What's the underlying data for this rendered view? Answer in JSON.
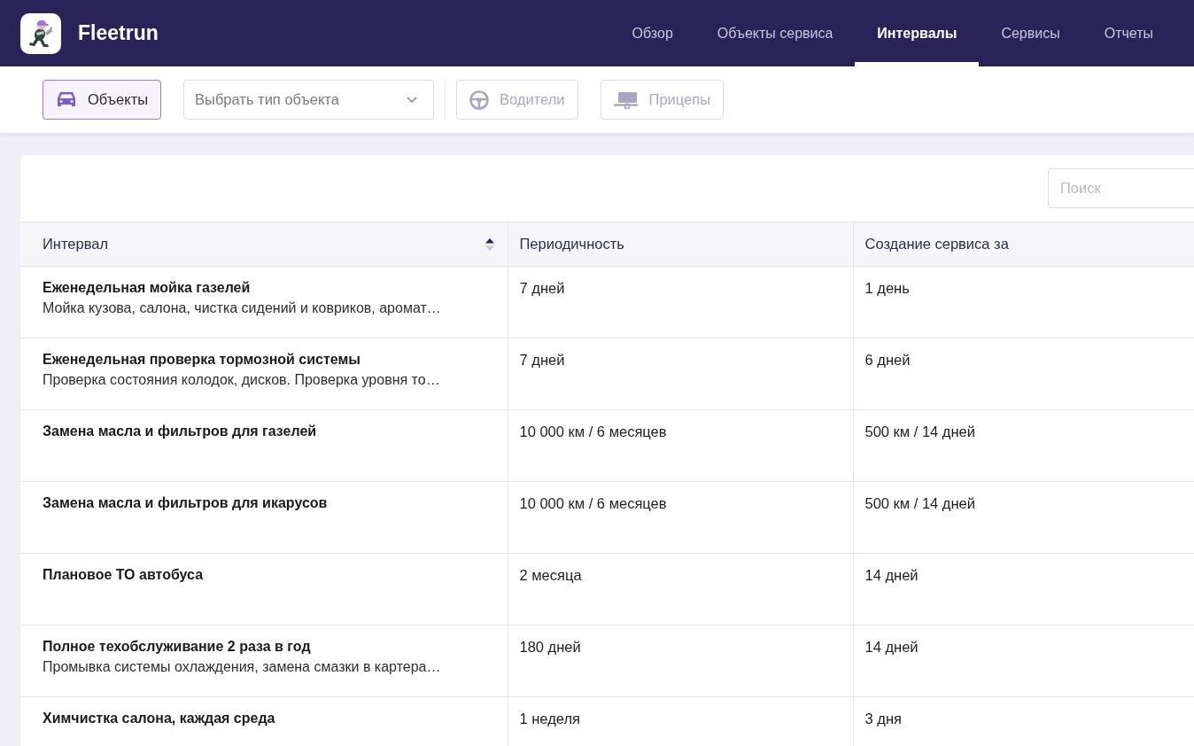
{
  "app": {
    "name": "Fleetrun"
  },
  "nav": {
    "tabs": [
      {
        "label": "Обзор",
        "selected": false
      },
      {
        "label": "Объекты сервиса",
        "selected": false
      },
      {
        "label": "Интервалы",
        "selected": true
      },
      {
        "label": "Сервисы",
        "selected": false
      },
      {
        "label": "Отчеты",
        "selected": false
      }
    ]
  },
  "toolbar": {
    "filters": [
      {
        "kind": "car",
        "label": "Объекты",
        "selected": true
      },
      {
        "kind": "steering-wheel",
        "label": "Водители",
        "selected": false
      },
      {
        "kind": "trailer",
        "label": "Прицепы",
        "selected": false
      }
    ],
    "type_select": {
      "placeholder": "Выбрать тип объекта"
    }
  },
  "search": {
    "placeholder": "Поиск"
  },
  "table": {
    "columns": [
      {
        "label": "Интервал",
        "sort_ascending": true
      },
      {
        "label": "Периодичность"
      },
      {
        "label": "Создание сервиса за"
      }
    ],
    "rows": [
      {
        "name": "Еженедельная мойка газелей",
        "description": "Мойка кузова, салона, чистка сидений и ковриков, аромат…",
        "period": "7 дней",
        "lead_time": "1 день"
      },
      {
        "name": "Еженедельная проверка тормозной системы",
        "description": "Проверка состояния колодок, дисков. Проверка уровня то…",
        "period": "7 дней",
        "lead_time": "6 дней"
      },
      {
        "name": "Замена масла и фильтров для газелей",
        "period": "10 000 км / 6 месяцев",
        "lead_time": "500 км / 14 дней"
      },
      {
        "name": "Замена масла и фильтров для икарусов",
        "period": "10 000 км / 6 месяцев",
        "lead_time": "500 км / 14 дней"
      },
      {
        "name": "Плановое ТО автобуса",
        "period": "2 месяца",
        "lead_time": "14 дней"
      },
      {
        "name": "Полное техобслуживание 2 раза в год",
        "description": "Промывка системы охлаждения, замена смазки в картера…",
        "period": "180 дней",
        "lead_time": "14 дней"
      },
      {
        "name": "Химчистка салона, каждая среда",
        "period": "1 неделя",
        "lead_time": "3 дня"
      }
    ]
  }
}
